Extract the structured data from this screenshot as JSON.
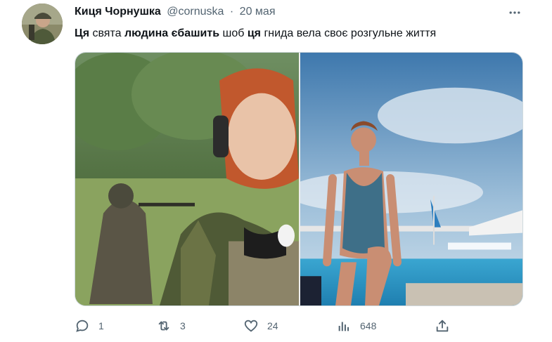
{
  "tweet": {
    "author_name": "Киця Чорнушка",
    "author_handle": "@cornuska",
    "separator": "·",
    "date": "20 мая",
    "text_parts": [
      {
        "text": "Ця",
        "bold": true
      },
      {
        "text": " свята ",
        "bold": false
      },
      {
        "text": "людина єбашить",
        "bold": true
      },
      {
        "text": " шоб ",
        "bold": false
      },
      {
        "text": "ця",
        "bold": true
      },
      {
        "text": " гнида вела своє розгульне життя",
        "bold": false
      }
    ]
  },
  "actions": {
    "replies": "1",
    "retweets": "3",
    "likes": "24",
    "views": "648"
  },
  "icons": {
    "more": "more-horizontal-icon",
    "reply": "reply-icon",
    "retweet": "retweet-icon",
    "like": "heart-icon",
    "views": "views-icon",
    "share": "share-icon"
  },
  "colors": {
    "text_primary": "#0f1419",
    "text_secondary": "#536471",
    "border": "#cfd9de"
  }
}
